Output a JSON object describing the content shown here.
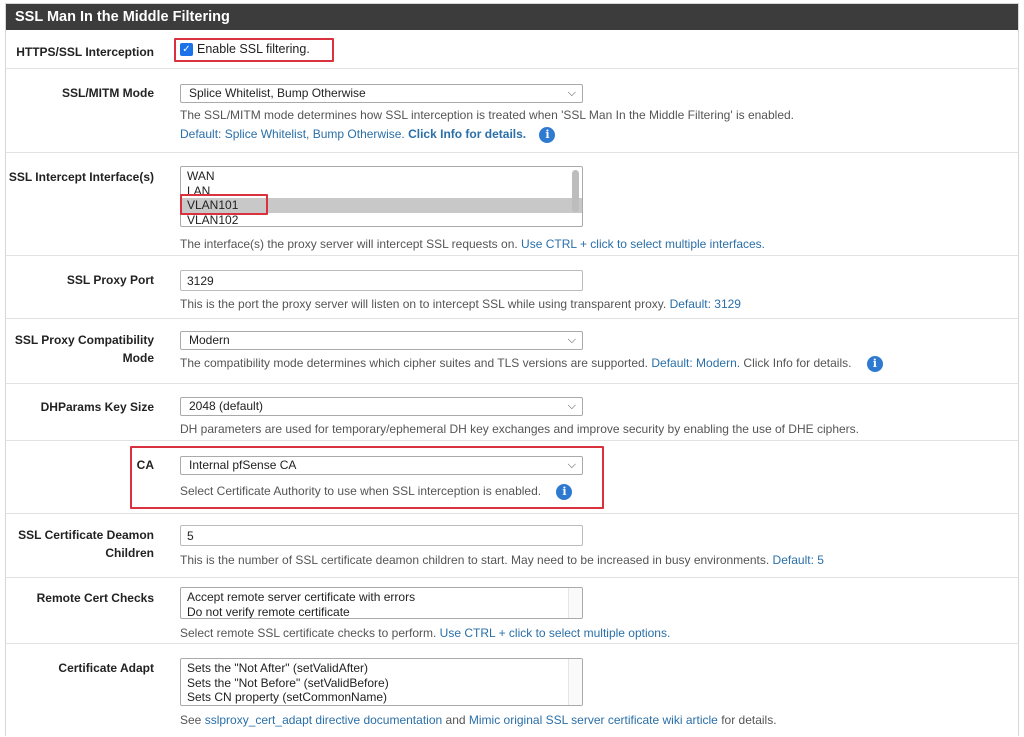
{
  "panel": {
    "title": "SSL Man In the Middle Filtering"
  },
  "https": {
    "label": "HTTPS/SSL Interception",
    "checkbox_label": "Enable SSL filtering."
  },
  "mitm": {
    "label": "SSL/MITM Mode",
    "value": "Splice Whitelist, Bump Otherwise",
    "help": "The SSL/MITM mode determines how SSL interception is treated when 'SSL Man In the Middle Filtering' is enabled.",
    "default_text": "Default: Splice Whitelist, Bump Otherwise.",
    "info_text": "Click Info for details."
  },
  "interfaces": {
    "label": "SSL Intercept Interface(s)",
    "options": [
      "WAN",
      "LAN",
      "VLAN101",
      "VLAN102"
    ],
    "selected": "VLAN101",
    "help": "The interface(s) the proxy server will intercept SSL requests on.",
    "help_link": "Use CTRL + click to select multiple interfaces."
  },
  "proxy_port": {
    "label": "SSL Proxy Port",
    "value": "3129",
    "help": "This is the port the proxy server will listen on to intercept SSL while using transparent proxy.",
    "default_text": "Default: 3129"
  },
  "compat": {
    "label": "SSL Proxy Compatibility Mode",
    "value": "Modern",
    "help": "The compatibility mode determines which cipher suites and TLS versions are supported.",
    "default_text": "Default: Modern.",
    "info_text": "Click Info for details."
  },
  "dhparams": {
    "label": "DHParams Key Size",
    "value": "2048 (default)",
    "help": "DH parameters are used for temporary/ephemeral DH key exchanges and improve security by enabling the use of DHE ciphers."
  },
  "ca": {
    "label": "CA",
    "value": "Internal pfSense CA",
    "help": "Select Certificate Authority to use when SSL interception is enabled."
  },
  "deamon": {
    "label": "SSL Certificate Deamon Children",
    "value": "5",
    "help": "This is the number of SSL certificate deamon children to start. May need to be increased in busy environments.",
    "default_text": "Default: 5"
  },
  "remote_checks": {
    "label": "Remote Cert Checks",
    "options": [
      "Accept remote server certificate with errors",
      "Do not verify remote certificate"
    ],
    "help": "Select remote SSL certificate checks to perform.",
    "help_link": "Use CTRL + click to select multiple options."
  },
  "cert_adapt": {
    "label": "Certificate Adapt",
    "options": [
      "Sets the \"Not After\" (setValidAfter)",
      "Sets the \"Not Before\" (setValidBefore)",
      "Sets CN property (setCommonName)"
    ],
    "help_prefix": "See",
    "link1": "sslproxy_cert_adapt directive documentation",
    "help_and": "and",
    "link2": "Mimic original SSL server certificate wiki article",
    "help_suffix": "for details."
  },
  "icons": {
    "info": "info-icon",
    "checkbox": "checkbox-checked-icon",
    "dropdown": "chevron-down-icon"
  },
  "colors": {
    "header_bg": "#3c3c3c",
    "link": "#2a6fa8",
    "info": "#2e7ad1",
    "highlight": "#d9313d"
  }
}
